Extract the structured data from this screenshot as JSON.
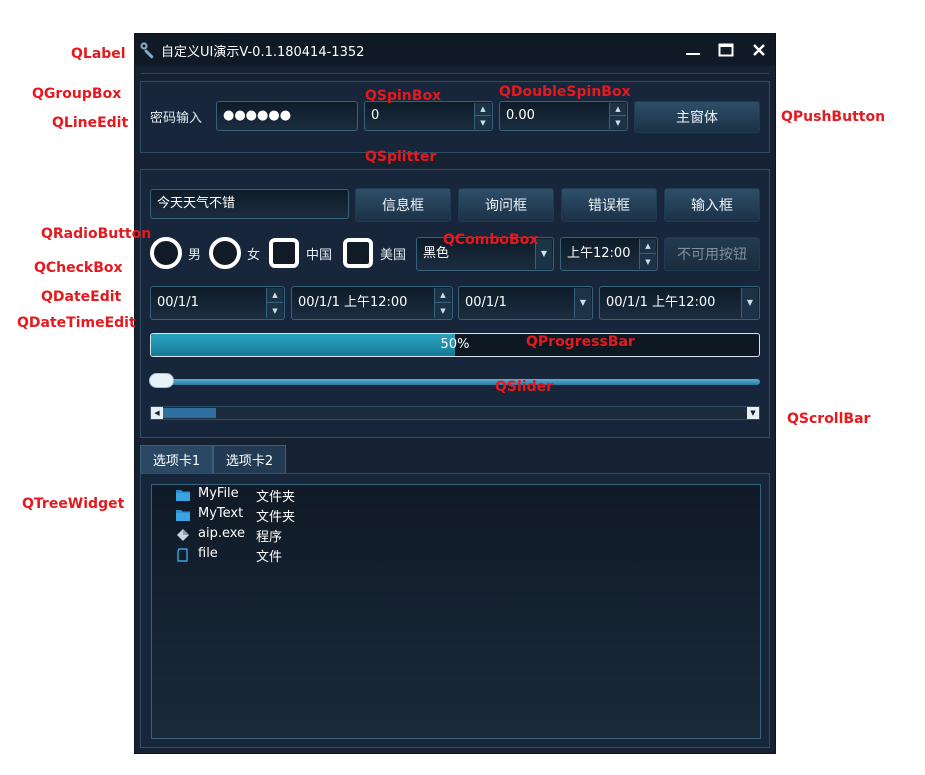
{
  "annotations": {
    "qlabel": "QLabel",
    "qgroupbox": "QGroupBox",
    "qlineedit": "QLineEdit",
    "qspinbox": "QSpinBox",
    "qdoublespinbox": "QDoubleSpinBox",
    "qpushbutton": "QPushButton",
    "qsplitter": "QSplitter",
    "qradiobutton": "QRadioButton",
    "qcombobox": "QComboBox",
    "qcheckbox": "QCheckBox",
    "qdateedit": "QDateEdit",
    "qdatetimeedit": "QDateTimeEdit",
    "qprogressbar": "QProgressBar",
    "qslider": "QSlider",
    "qscrollbar": "QScrollBar",
    "qtreewidget": "QTreeWidget"
  },
  "window": {
    "title": "自定义UI演示V-0.1.180414-1352",
    "controls": [
      "minimize",
      "maximize",
      "close"
    ]
  },
  "group1": {
    "password_label": "密码输入",
    "password_value": "●●●●●●",
    "spin_value": "0",
    "double_spin_value": "0.00",
    "main_window_button": "主窗体"
  },
  "group2": {
    "text_input_value": "今天天气不错",
    "buttons": {
      "info": "信息框",
      "question": "询问框",
      "error": "错误框",
      "input": "输入框"
    },
    "radio_male": "男",
    "radio_female": "女",
    "check_china": "中国",
    "check_usa": "美国",
    "combo_value": "黑色",
    "time_value": "上午12:00",
    "disabled_button": "不可用按钮",
    "date_edit_1": "00/1/1",
    "datetime_edit_1": "00/1/1 上午12:00",
    "date_edit_2": "00/1/1",
    "datetime_edit_2": "00/1/1 上午12:00",
    "progress_value": 0.5,
    "progress_text": "50%",
    "slider_value": 0,
    "scrollbar_value": 0
  },
  "tabs": [
    {
      "label": "选项卡1",
      "active": true
    },
    {
      "label": "选项卡2",
      "active": false
    }
  ],
  "tree": {
    "items": [
      {
        "name": "MyFile",
        "type": "文件夹",
        "icon": "folder-icon"
      },
      {
        "name": "MyText",
        "type": "文件夹",
        "icon": "folder-icon"
      },
      {
        "name": "aip.exe",
        "type": "程序",
        "icon": "executable-icon"
      },
      {
        "name": "file",
        "type": "文件",
        "icon": "file-icon"
      }
    ]
  },
  "colors": {
    "annotation": "#e5191e",
    "window_bg": "#162231",
    "titlebar_bg": "#0f1a26",
    "accent": "#2aa3c0"
  }
}
